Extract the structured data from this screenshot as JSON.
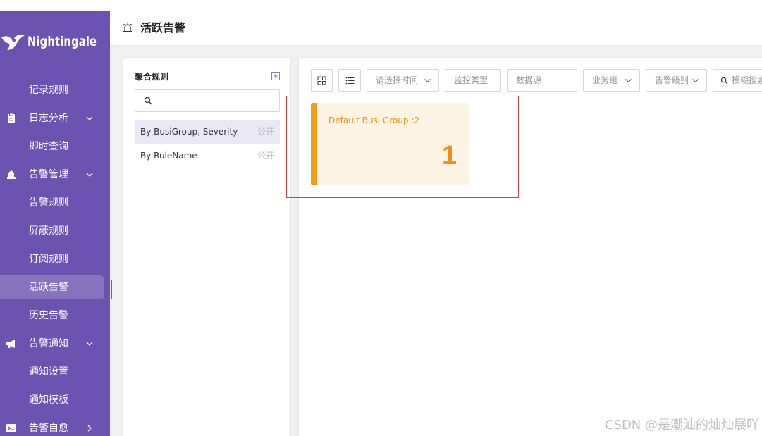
{
  "app": {
    "logo_text": "Nightingale"
  },
  "sidebar": {
    "items": [
      {
        "label": "记录规则",
        "icon": null,
        "chevron": null,
        "active": false
      },
      {
        "label": "日志分析",
        "icon": "clipboard-icon",
        "chevron": "down",
        "active": false
      },
      {
        "label": "即时查询",
        "icon": null,
        "chevron": null,
        "active": false
      },
      {
        "label": "告警管理",
        "icon": "alarm-bell-icon",
        "chevron": "down",
        "active": false
      },
      {
        "label": "告警规则",
        "icon": null,
        "chevron": null,
        "active": false
      },
      {
        "label": "屏蔽规则",
        "icon": null,
        "chevron": null,
        "active": false
      },
      {
        "label": "订阅规则",
        "icon": null,
        "chevron": null,
        "active": false
      },
      {
        "label": "活跃告警",
        "icon": null,
        "chevron": null,
        "active": true
      },
      {
        "label": "历史告警",
        "icon": null,
        "chevron": null,
        "active": false
      },
      {
        "label": "告警通知",
        "icon": "megaphone-icon",
        "chevron": "down",
        "active": false
      },
      {
        "label": "通知设置",
        "icon": null,
        "chevron": null,
        "active": false
      },
      {
        "label": "通知模板",
        "icon": null,
        "chevron": null,
        "active": false
      },
      {
        "label": "告警自愈",
        "icon": "terminal-icon",
        "chevron": "right",
        "active": false
      }
    ]
  },
  "header": {
    "title": "活跃告警",
    "icon": "siren-icon"
  },
  "aggregation": {
    "title": "聚合规则",
    "search": {
      "value": "",
      "placeholder": ""
    },
    "rules": [
      {
        "name": "By BusiGroup, Severity",
        "tag": "公开",
        "selected": true
      },
      {
        "name": "By RuleName",
        "tag": "公开",
        "selected": false
      }
    ]
  },
  "toolbar": {
    "view_card_icon": "grid-icon",
    "view_list_icon": "list-icon",
    "time_placeholder": "请选择时间",
    "monitor_type_placeholder": "监控类型",
    "datasource_placeholder": "数据源",
    "busi_group_placeholder": "业务组",
    "severity_placeholder": "告警级别",
    "search_placeholder": "模糊搜索"
  },
  "cards": [
    {
      "name": "Default Busi Group::2",
      "count": "1"
    }
  ],
  "colors": {
    "sidebar_bg": "#6c53b1",
    "card_bg": "#fdf4e4",
    "card_accent": "#f59b1a",
    "highlight_box": "#e53a3a"
  },
  "watermark": "CSDN @是潮汕的灿灿展吖"
}
